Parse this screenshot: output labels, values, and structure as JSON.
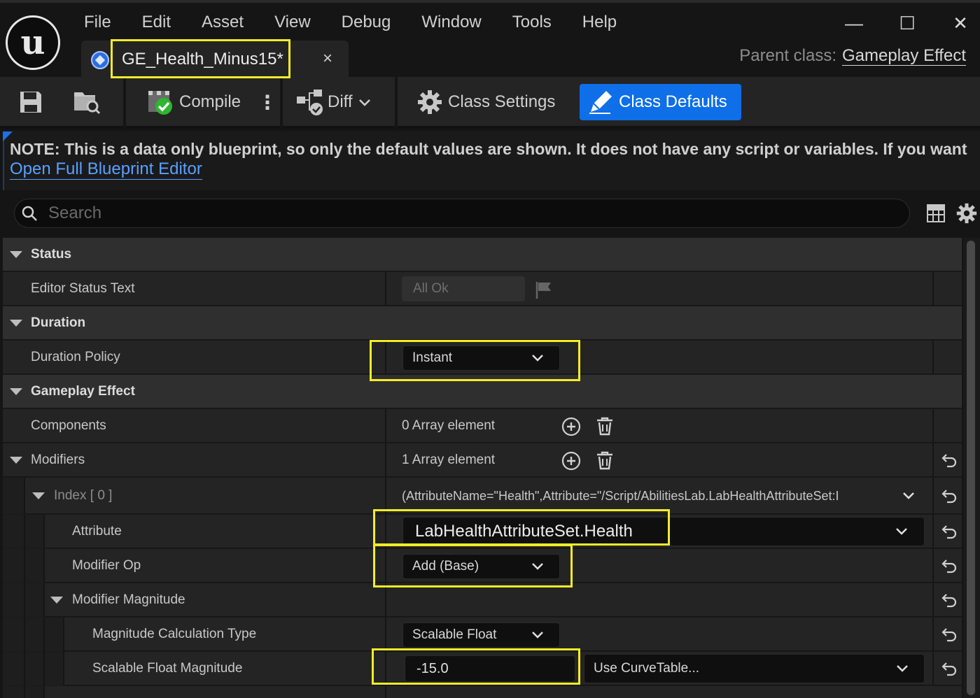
{
  "menu": [
    "File",
    "Edit",
    "Asset",
    "View",
    "Debug",
    "Window",
    "Tools",
    "Help"
  ],
  "window_controls": {
    "minimize": "—",
    "maximize": "☐",
    "close": "✕"
  },
  "tab": {
    "title": "GE_Health_Minus15*",
    "close": "×"
  },
  "parent_class": {
    "label": "Parent class:",
    "value": "Gameplay Effect"
  },
  "toolbar": {
    "compile": "Compile",
    "more": "⋮",
    "diff": "Diff",
    "class_settings": "Class Settings",
    "class_defaults": "Class Defaults"
  },
  "note": {
    "text": "NOTE: This is a data only blueprint, so only the default values are shown.  It does not have any script or variables.  If you want",
    "link": "Open Full Blueprint Editor"
  },
  "search": {
    "placeholder": "Search"
  },
  "details": {
    "status_cat": "Status",
    "editor_status_text": "Editor Status Text",
    "editor_status_value": "All Ok",
    "duration_cat": "Duration",
    "duration_policy": "Duration Policy",
    "duration_policy_value": "Instant",
    "gameplay_effect_cat": "Gameplay Effect",
    "components": "Components",
    "components_value": "0 Array element",
    "modifiers": "Modifiers",
    "modifiers_value": "1 Array element",
    "index_label": "Index [ 0 ]",
    "index_value": "(AttributeName=\"Health\",Attribute=\"/Script/AbilitiesLab.LabHealthAttributeSet:I",
    "attribute": "Attribute",
    "attribute_value": "LabHealthAttributeSet.Health",
    "modifier_op": "Modifier Op",
    "modifier_op_value": "Add (Base)",
    "modifier_magnitude": "Modifier Magnitude",
    "mag_calc_type": "Magnitude Calculation Type",
    "mag_calc_type_value": "Scalable Float",
    "scalable_float_magnitude": "Scalable Float Magnitude",
    "scalable_float_value": "-15.0",
    "curve_table": "Use CurveTable..."
  },
  "colors": {
    "accent": "#0e6fe8",
    "highlight": "#f2ec28",
    "link": "#5aa0ff"
  }
}
